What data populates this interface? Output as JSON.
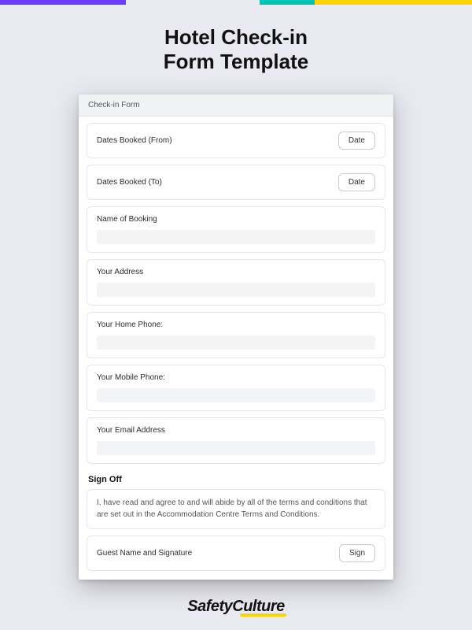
{
  "page": {
    "title_line1": "Hotel Check-in",
    "title_line2": "Form Template"
  },
  "form": {
    "header": "Check-in Form",
    "dateButtonLabel": "Date",
    "signButtonLabel": "Sign",
    "sectionSignOff": "Sign Off",
    "agreementText": "I, have read and agree to and will abide by all of the terms and conditions that are set out in the Accommodation Centre Terms and Conditions.",
    "fields": {
      "dates_from": {
        "label": "Dates Booked (From)"
      },
      "dates_to": {
        "label": "Dates Booked (To)"
      },
      "booking_name": {
        "label": "Name of Booking",
        "value": ""
      },
      "address": {
        "label": "Your Address",
        "value": ""
      },
      "home_phone": {
        "label": "Your Home Phone:",
        "value": ""
      },
      "mobile_phone": {
        "label": "Your Mobile Phone:",
        "value": ""
      },
      "email": {
        "label": "Your Email Address",
        "value": ""
      },
      "signature": {
        "label": "Guest Name and Signature"
      }
    }
  },
  "brand": {
    "name": "SafetyCulture"
  },
  "colors": {
    "purple": "#6a3cff",
    "teal": "#00c3b3",
    "yellow": "#ffd200",
    "page_bg": "#e9eaf1"
  }
}
